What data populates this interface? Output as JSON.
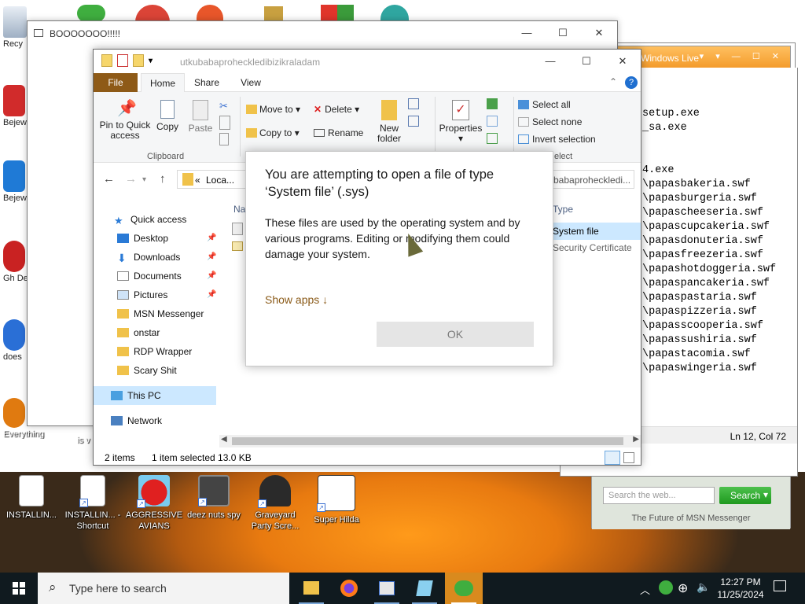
{
  "desktop": {
    "left_labels": [
      "Recy",
      "Bejew De",
      "Bejew De",
      "Gh De",
      "does",
      "Everything"
    ],
    "bottom_icons": [
      {
        "label": "INSTALLIN..."
      },
      {
        "label": "INSTALLIN... - Shortcut"
      },
      {
        "label": "AGGRESSIVE AVIANS"
      },
      {
        "label": "deez nuts spy"
      },
      {
        "label": "Graveyard Party Scre..."
      },
      {
        "label": "Super Hilda"
      }
    ],
    "partial_label_is": "is v"
  },
  "boo_window": {
    "title": "BOOOOOOO!!!!!",
    "controls": [
      "—",
      "☐",
      "✕"
    ]
  },
  "notepad": {
    "lines": [
      "setup.exe",
      "_sa.exe",
      "",
      "",
      "4.exe",
      "\\papasbakeria.swf",
      "\\papasburgeria.swf",
      "\\papascheeseria.swf",
      "\\papascupcakeria.swf",
      "\\papasdonuteria.swf",
      "\\papasfreezeria.swf",
      "\\papashotdoggeria.swf",
      "\\papaspancakeria.swf",
      "\\papaspastaria.swf",
      "\\papaspizzeria.swf",
      "\\papasscooperia.swf",
      "\\papassushiria.swf",
      "\\papastacomia.swf",
      "\\papaswingeria.swf"
    ],
    "status": "Ln 12, Col 72"
  },
  "msn": {
    "title": "Windows Live",
    "search_placeholder": "Search the web...",
    "search_button": "Search",
    "footer": "The Future of MSN Messenger"
  },
  "explorer": {
    "title_path": "utkubabaproheckledibizikraladam",
    "tabs": {
      "file": "File",
      "home": "Home",
      "share": "Share",
      "view": "View"
    },
    "ribbon": {
      "pin": "Pin to Quick access",
      "copy": "Copy",
      "paste": "Paste",
      "clipboard": "Clipboard",
      "move_to": "Move to",
      "delete": "Delete",
      "copy_to": "Copy to",
      "rename": "Rename",
      "new_folder": "New folder",
      "properties": "Properties",
      "select_all": "Select all",
      "select_none": "Select none",
      "invert_selection": "Invert selection",
      "select_group": "elect"
    },
    "address": {
      "crumb": "Loca...",
      "chevron": "«",
      "right_crumb": "babaproheckledi..."
    },
    "nav": {
      "quick_access": "Quick access",
      "desktop": "Desktop",
      "downloads": "Downloads",
      "documents": "Documents",
      "pictures": "Pictures",
      "msn_messenger": "MSN Messenger",
      "onstar": "onstar",
      "rdp_wrapper": "RDP Wrapper",
      "scary_shit": "Scary Shit",
      "this_pc": "This PC",
      "network": "Network"
    },
    "content": {
      "col_name_partial": "Na",
      "col_type": "Type",
      "types": [
        "System file",
        "Security Certificate"
      ]
    },
    "status": {
      "items": "2 items",
      "selected": "1 item selected  13.0 KB"
    }
  },
  "dialog": {
    "title": "You are attempting to open a file of type ‘System file’ (.sys)",
    "body": "These files are used by the operating system and by various programs. Editing or modifying them could damage your system.",
    "link": "Show apps ↓",
    "ok": "OK"
  },
  "taskbar": {
    "search_placeholder": "Type here to search",
    "time": "12:27 PM",
    "date": "11/25/2024"
  },
  "colors": {
    "file_tab": "#8e5a17",
    "selection": "#cce8ff",
    "taskbar": "#101a1f",
    "msn_orange": "#f39a2a",
    "link": "#8a5a18"
  }
}
